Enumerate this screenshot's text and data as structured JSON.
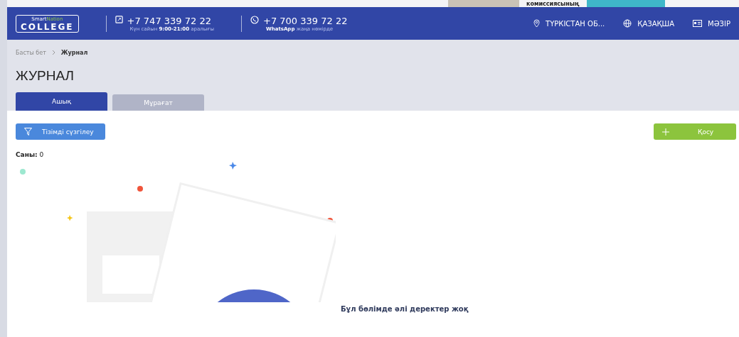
{
  "banner": {
    "text": "комиссиясының"
  },
  "header": {
    "logo": {
      "top": "Smart",
      "top_accent": "Nation",
      "bottom": "COLLEGE"
    },
    "contacts": [
      {
        "kind": "phone",
        "number": "+7 747 339 72 22",
        "note": "Күн сайын **9:00-21:00** аралығы"
      },
      {
        "kind": "whatsapp",
        "number": "+7 700 339 72 22",
        "note": "**WhatsApp** жаңа нөмірде"
      }
    ],
    "actions": [
      {
        "kind": "location",
        "label": "ТҮРКІСТАН ОБ..."
      },
      {
        "kind": "language",
        "label": "ҚАЗАҚША"
      },
      {
        "kind": "menu",
        "label": "МӘЗІР"
      }
    ]
  },
  "breadcrumbs": [
    {
      "label": "Басты бет",
      "current": false
    },
    {
      "label": "Журнал",
      "current": true
    }
  ],
  "title": "ЖУРНАЛ",
  "tabs": [
    {
      "label": "Ашық",
      "selected": true
    },
    {
      "label": "Мұрағат",
      "selected": false
    }
  ],
  "filter_button": "Тізімді сүзгілеу",
  "add_button": "Қосу",
  "count": {
    "label": "Саны:",
    "value": "0"
  },
  "empty_message": "Бұл бөлімде әлі деректер жоқ"
}
